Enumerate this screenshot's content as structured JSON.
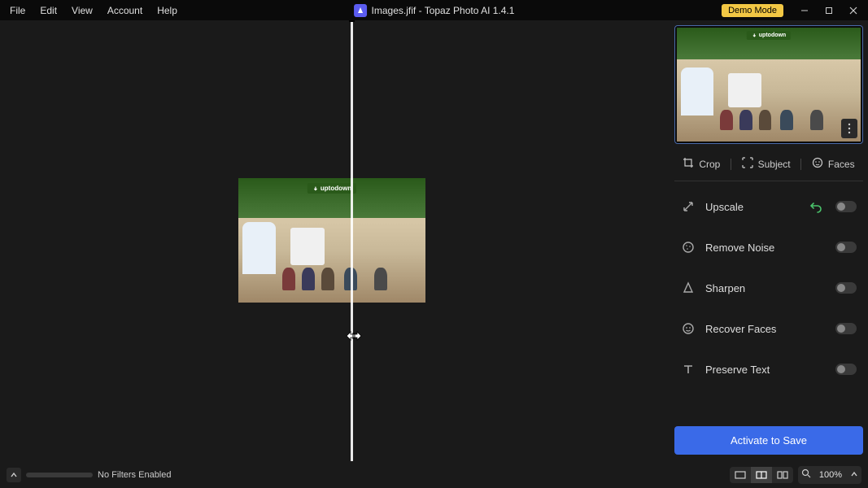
{
  "menubar": {
    "items": [
      "File",
      "Edit",
      "View",
      "Account",
      "Help"
    ]
  },
  "title": {
    "filename": "Images.jfif",
    "separator": " - ",
    "appname": "Topaz Photo AI 1.4.1"
  },
  "demo_badge": "Demo Mode",
  "image_logo": "uptodown",
  "tools": {
    "crop": "Crop",
    "subject": "Subject",
    "faces": "Faces"
  },
  "filters": {
    "upscale": {
      "label": "Upscale",
      "enabled": false,
      "has_undo": true
    },
    "remove_noise": {
      "label": "Remove Noise",
      "enabled": false
    },
    "sharpen": {
      "label": "Sharpen",
      "enabled": false
    },
    "recover_faces": {
      "label": "Recover Faces",
      "enabled": false
    },
    "preserve_text": {
      "label": "Preserve Text",
      "enabled": false
    }
  },
  "activate_button": "Activate to Save",
  "bottombar": {
    "status": "No Filters Enabled",
    "zoom": "100%"
  }
}
